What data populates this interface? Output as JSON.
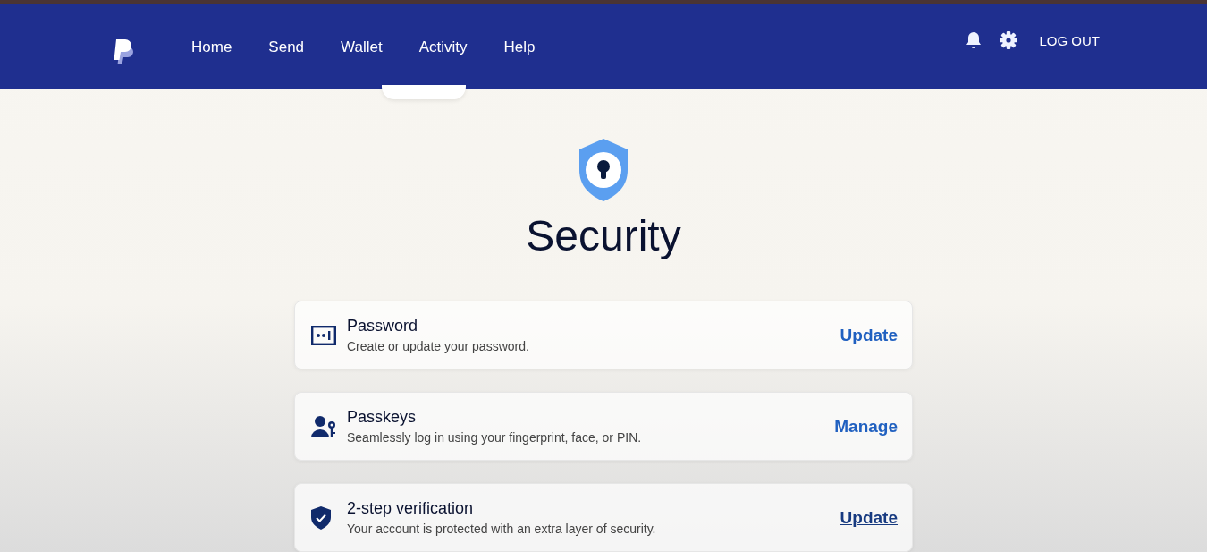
{
  "nav": {
    "links": [
      {
        "label": "Home"
      },
      {
        "label": "Send"
      },
      {
        "label": "Wallet"
      },
      {
        "label": "Activity"
      },
      {
        "label": "Help"
      }
    ],
    "logout": "LOG OUT"
  },
  "page": {
    "title": "Security"
  },
  "items": [
    {
      "kind": "password",
      "title": "Password",
      "description": "Create or update your password.",
      "action": "Update",
      "hovered": false
    },
    {
      "kind": "passkeys",
      "title": "Passkeys",
      "description": "Seamlessly log in using your fingerprint, face, or PIN.",
      "action": "Manage",
      "hovered": false
    },
    {
      "kind": "two_step",
      "title": "2-step verification",
      "description": "Your account is protected with an extra layer of security.",
      "action": "Update",
      "hovered": true
    }
  ]
}
